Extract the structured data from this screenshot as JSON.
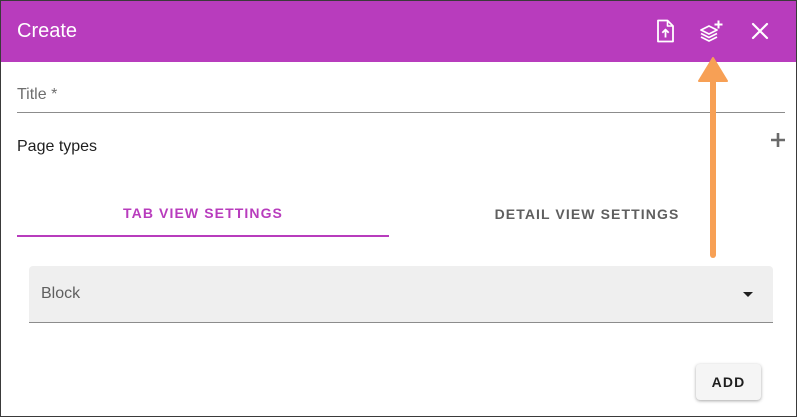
{
  "dialog": {
    "title": "Create",
    "header_icons": [
      "file-upload-icon",
      "layers-plus-icon",
      "close-icon"
    ]
  },
  "form": {
    "title_label": "Title *",
    "page_types_label": "Page types",
    "add_page_type_icon": "plus-icon"
  },
  "tabs": [
    {
      "label": "TAB VIEW SETTINGS",
      "active": true
    },
    {
      "label": "DETAIL VIEW SETTINGS",
      "active": false
    }
  ],
  "select": {
    "value": "Block",
    "icon": "dropdown-caret-icon"
  },
  "actions": {
    "add_label": "ADD"
  },
  "colors": {
    "header_bg": "#b83cbd",
    "accent": "#b83cbd",
    "annotation_arrow": "#f7a055"
  },
  "annotation": {
    "type": "arrow",
    "points_to": "layers-plus-icon"
  }
}
